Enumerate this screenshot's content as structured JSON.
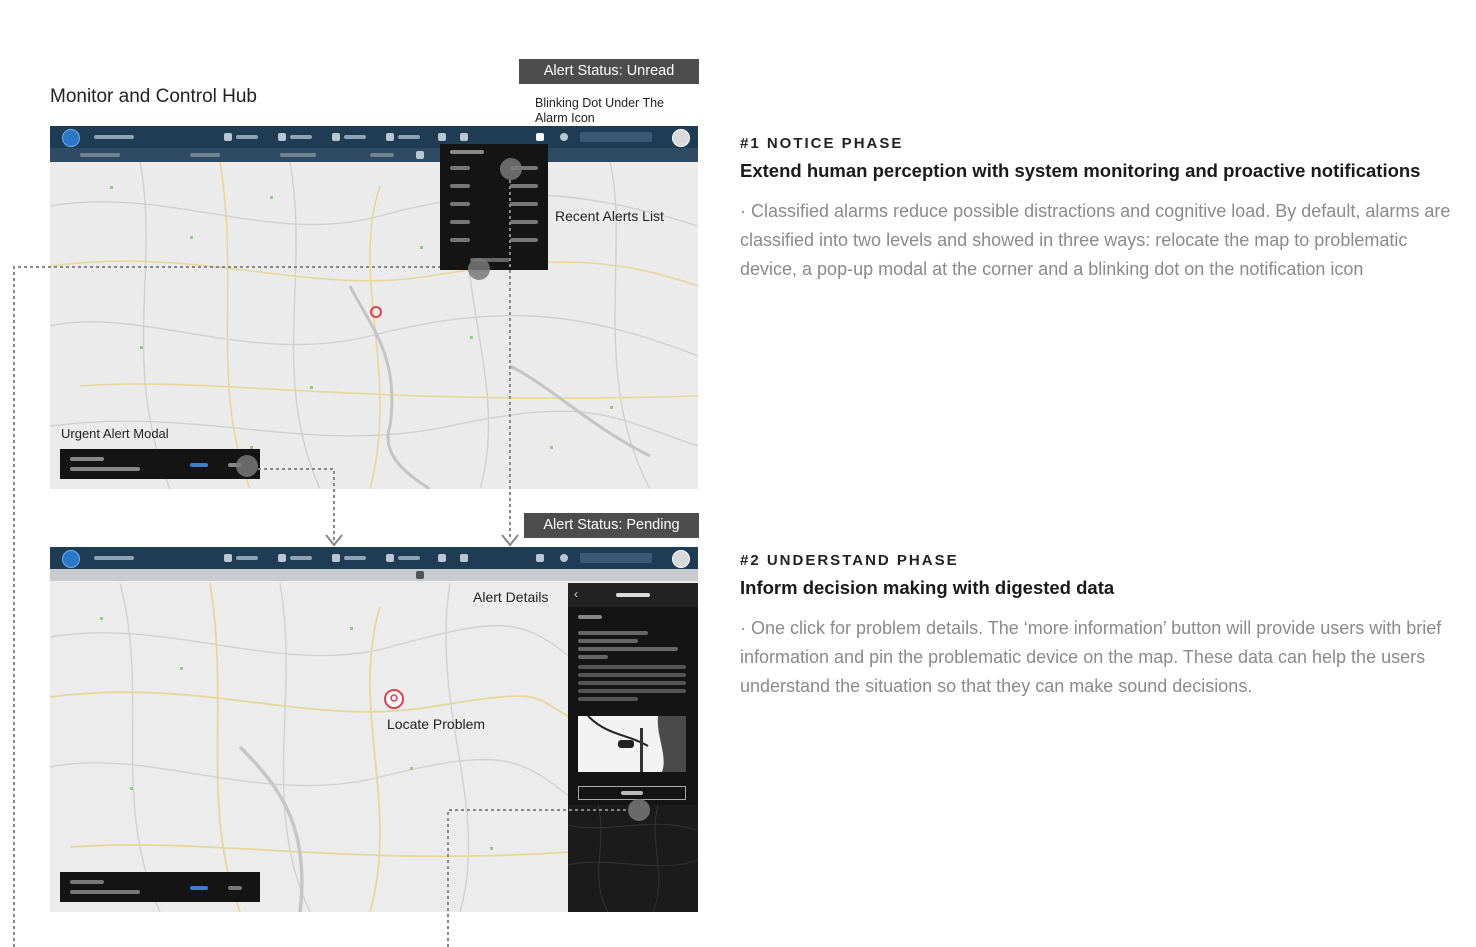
{
  "page": {
    "heading": "Monitor and Control Hub"
  },
  "screen1": {
    "status_badge": "Alert Status: Unread",
    "blinking_label": "Blinking Dot Under The Alarm Icon",
    "recent_label": "Recent Alerts List",
    "urgent_label": "Urgent Alert Modal"
  },
  "screen2": {
    "status_badge": "Alert Status: Pending",
    "details_label": "Alert Details",
    "locate_label": "Locate Problem"
  },
  "phase1": {
    "tag": "#1 NOTICE PHASE",
    "title": "Extend human perception with system monitoring and proactive notifications",
    "body": "· Classified alarms reduce possible distractions and cognitive load. By default, alarms are classified into two levels and showed in three ways:  relocate the map to problematic device, a pop-up modal at the corner and a blinking dot on the notification icon"
  },
  "phase2": {
    "tag": "#2 UNDERSTAND PHASE",
    "title": "Inform decision making with digested data",
    "body": "· One click for problem details. The ‘more information’ button will provide users with brief information and pin the problematic device on the map. These data can help the users understand the situation so that they can make sound decisions."
  },
  "colors": {
    "navbar": "#1f3c55",
    "badge": "#4d4d4d",
    "pin": "#d9434f",
    "panel": "#141414"
  },
  "icons": [
    "bell-icon",
    "map-pin-icon",
    "chevron-left-icon",
    "search-icon",
    "arrow-down-icon"
  ]
}
